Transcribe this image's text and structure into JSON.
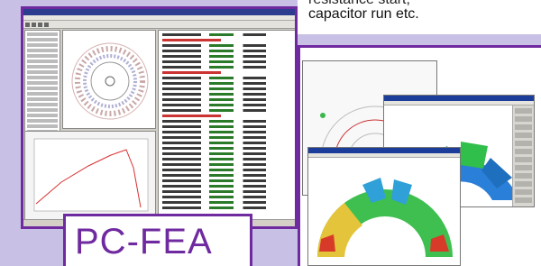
{
  "caption": {
    "line1": "resistance start,",
    "line2": "capacitor run etc."
  },
  "brand": {
    "label": "PC-FEA"
  },
  "colors": {
    "frame": "#6f2aa0",
    "background": "#c9c0e6",
    "window_title": "#2c3d8f",
    "curve": "#d93030",
    "mesh": "#c9a7a7"
  }
}
